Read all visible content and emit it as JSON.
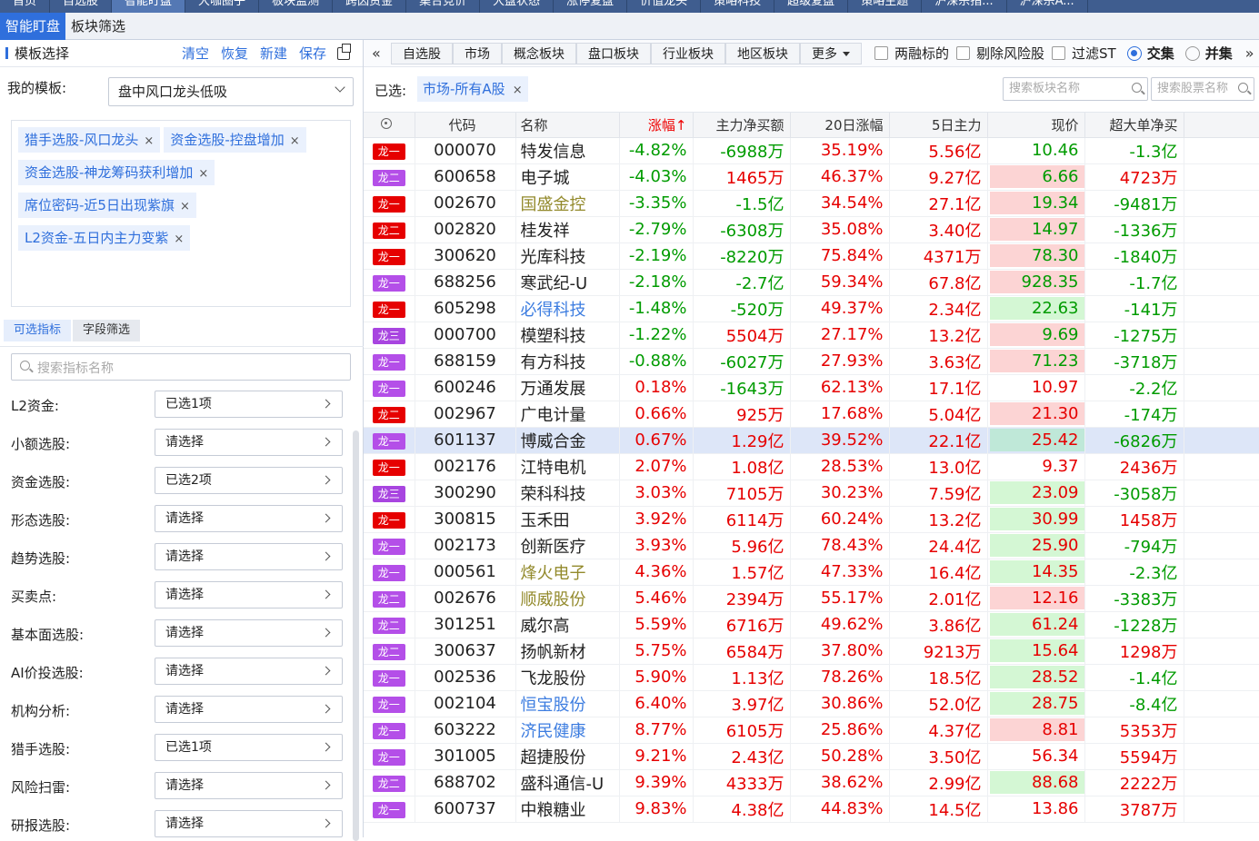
{
  "top_nav": [
    "首页",
    "自选股",
    "智能盯盘",
    "大咖圈子",
    "板块监测",
    "跨因资金",
    "集合竞价",
    "大盘状态",
    "涨停复盘",
    "价值龙头",
    "策略科技",
    "超级复盘",
    "策略主题",
    "沪深宗指...",
    "沪深宗A..."
  ],
  "top_nav_active": 2,
  "sub_tabs": [
    "智能盯盘",
    "板块筛选"
  ],
  "left": {
    "title": "模板选择",
    "actions": [
      "清空",
      "恢复",
      "新建",
      "保存"
    ],
    "my_template_label": "我的模板:",
    "my_template_value": "盘中风口龙头低吸",
    "tags": [
      "猎手选股-风口龙头",
      "资金选股-控盘增加",
      "资金选股-神龙筹码获利增加",
      "席位密码-近5日出现紫旗",
      "L2资金-五日内主力变紫"
    ],
    "tabs": [
      "可选指标",
      "字段筛选"
    ],
    "search_placeholder": "搜索指标名称",
    "filters": [
      {
        "label": "L2资金:",
        "value": "已选1项"
      },
      {
        "label": "小额选股:",
        "value": "请选择"
      },
      {
        "label": "资金选股:",
        "value": "已选2项"
      },
      {
        "label": "形态选股:",
        "value": "请选择"
      },
      {
        "label": "趋势选股:",
        "value": "请选择"
      },
      {
        "label": "买卖点:",
        "value": "请选择"
      },
      {
        "label": "基本面选股:",
        "value": "请选择"
      },
      {
        "label": "AI价投选股:",
        "value": "请选择"
      },
      {
        "label": "机构分析:",
        "value": "请选择"
      },
      {
        "label": "猎手选股:",
        "value": "已选1项"
      },
      {
        "label": "风险扫雷:",
        "value": "请选择"
      },
      {
        "label": "研报选股:",
        "value": "请选择"
      }
    ]
  },
  "toolbar": {
    "left_arrow": "«",
    "right_arrow": "»",
    "buttons": [
      "自选股",
      "市场",
      "概念板块",
      "盘口板块",
      "行业板块",
      "地区板块"
    ],
    "more": "更多",
    "checks": [
      "两融标的",
      "剔除风险股",
      "过滤ST"
    ],
    "radios": [
      "交集",
      "并集"
    ],
    "radio_selected": 0
  },
  "selected": {
    "label": "已选:",
    "chip": "市场-所有A股",
    "search_sector_placeholder": "搜索板块名称",
    "search_stock_placeholder": "搜索股票名称"
  },
  "table": {
    "headers": [
      "代码",
      "名称",
      "涨幅↑",
      "主力净买额",
      "20日涨幅",
      "5日主力",
      "现价",
      "超大单净买"
    ],
    "badge_colors": {
      "龙一": "#e60000",
      "龙二": "#b44fe8",
      "龙三": "#a845e0"
    },
    "rows": [
      {
        "badge": "龙一",
        "bc": "#e60000",
        "code": "000070",
        "name": "特发信息",
        "nc": "blk",
        "chg": "-4.82%",
        "cc": "dn",
        "net": "-6988万",
        "netc": "dn",
        "d20": "35.19%",
        "d20c": "up",
        "m5": "5.56亿",
        "m5c": "up",
        "price": "10.46",
        "pc": "dn",
        "pbg": "",
        "sup": "-1.3亿",
        "supc": "dn"
      },
      {
        "badge": "龙二",
        "bc": "#b44fe8",
        "code": "600658",
        "name": "电子城",
        "nc": "blk",
        "chg": "-4.03%",
        "cc": "dn",
        "net": "1465万",
        "netc": "up",
        "d20": "46.37%",
        "d20c": "up",
        "m5": "9.27亿",
        "m5c": "up",
        "price": "6.66",
        "pc": "dn",
        "pbg": "#fcd4d4",
        "sup": "4723万",
        "supc": "up"
      },
      {
        "badge": "龙一",
        "bc": "#e60000",
        "code": "002670",
        "name": "国盛金控",
        "nc": "olv",
        "chg": "-3.35%",
        "cc": "dn",
        "net": "-1.5亿",
        "netc": "dn",
        "d20": "34.54%",
        "d20c": "up",
        "m5": "27.1亿",
        "m5c": "up",
        "price": "19.34",
        "pc": "dn",
        "pbg": "#fcd4d4",
        "sup": "-9481万",
        "supc": "dn"
      },
      {
        "badge": "龙二",
        "bc": "#e60000",
        "code": "002820",
        "name": "桂发祥",
        "nc": "blk",
        "chg": "-2.79%",
        "cc": "dn",
        "net": "-6308万",
        "netc": "dn",
        "d20": "35.08%",
        "d20c": "up",
        "m5": "3.40亿",
        "m5c": "up",
        "price": "14.97",
        "pc": "dn",
        "pbg": "#fcd4d4",
        "sup": "-1336万",
        "supc": "dn"
      },
      {
        "badge": "龙一",
        "bc": "#e60000",
        "code": "300620",
        "name": "光库科技",
        "nc": "blk",
        "chg": "-2.19%",
        "cc": "dn",
        "net": "-8220万",
        "netc": "dn",
        "d20": "75.84%",
        "d20c": "up",
        "m5": "4371万",
        "m5c": "up",
        "price": "78.30",
        "pc": "dn",
        "pbg": "#fcd4d4",
        "sup": "-1840万",
        "supc": "dn"
      },
      {
        "badge": "龙一",
        "bc": "#b44fe8",
        "code": "688256",
        "name": "寒武纪-U",
        "nc": "blk",
        "chg": "-2.18%",
        "cc": "dn",
        "net": "-2.7亿",
        "netc": "dn",
        "d20": "59.34%",
        "d20c": "up",
        "m5": "67.8亿",
        "m5c": "up",
        "price": "928.35",
        "pc": "dn",
        "pbg": "#fcd4d4",
        "sup": "-1.7亿",
        "supc": "dn"
      },
      {
        "badge": "龙一",
        "bc": "#e60000",
        "code": "605298",
        "name": "必得科技",
        "nc": "lnk",
        "chg": "-1.48%",
        "cc": "dn",
        "net": "-520万",
        "netc": "dn",
        "d20": "49.37%",
        "d20c": "up",
        "m5": "2.34亿",
        "m5c": "up",
        "price": "22.63",
        "pc": "dn",
        "pbg": "#d4f7d4",
        "sup": "-141万",
        "supc": "dn"
      },
      {
        "badge": "龙三",
        "bc": "#a845e0",
        "code": "000700",
        "name": "模塑科技",
        "nc": "blk",
        "chg": "-1.22%",
        "cc": "dn",
        "net": "5504万",
        "netc": "up",
        "d20": "27.17%",
        "d20c": "up",
        "m5": "13.2亿",
        "m5c": "up",
        "price": "9.69",
        "pc": "dn",
        "pbg": "#fcd4d4",
        "sup": "-1275万",
        "supc": "dn"
      },
      {
        "badge": "龙一",
        "bc": "#b44fe8",
        "code": "688159",
        "name": "有方科技",
        "nc": "blk",
        "chg": "-0.88%",
        "cc": "dn",
        "net": "-6027万",
        "netc": "dn",
        "d20": "27.93%",
        "d20c": "up",
        "m5": "3.63亿",
        "m5c": "up",
        "price": "71.23",
        "pc": "dn",
        "pbg": "#fcd4d4",
        "sup": "-3718万",
        "supc": "dn"
      },
      {
        "badge": "龙一",
        "bc": "#b44fe8",
        "code": "600246",
        "name": "万通发展",
        "nc": "blk",
        "chg": "0.18%",
        "cc": "up",
        "net": "-1643万",
        "netc": "dn",
        "d20": "62.13%",
        "d20c": "up",
        "m5": "17.1亿",
        "m5c": "up",
        "price": "10.97",
        "pc": "up",
        "pbg": "",
        "sup": "-2.2亿",
        "supc": "dn"
      },
      {
        "badge": "龙二",
        "bc": "#e60000",
        "code": "002967",
        "name": "广电计量",
        "nc": "blk",
        "chg": "0.66%",
        "cc": "up",
        "net": "925万",
        "netc": "up",
        "d20": "17.68%",
        "d20c": "up",
        "m5": "5.04亿",
        "m5c": "up",
        "price": "21.30",
        "pc": "up",
        "pbg": "#fcd4d4",
        "sup": "-174万",
        "supc": "dn"
      },
      {
        "badge": "龙一",
        "bc": "#b44fe8",
        "code": "601137",
        "name": "博威合金",
        "nc": "blk",
        "chg": "0.67%",
        "cc": "up",
        "net": "1.29亿",
        "netc": "up",
        "d20": "39.52%",
        "d20c": "up",
        "m5": "22.1亿",
        "m5c": "up",
        "price": "25.42",
        "pc": "up",
        "pbg": "#bfe8d8",
        "sup": "-6826万",
        "supc": "dn",
        "sel": true
      },
      {
        "badge": "龙一",
        "bc": "#e60000",
        "code": "002176",
        "name": "江特电机",
        "nc": "blk",
        "chg": "2.07%",
        "cc": "up",
        "net": "1.08亿",
        "netc": "up",
        "d20": "28.53%",
        "d20c": "up",
        "m5": "13.0亿",
        "m5c": "up",
        "price": "9.37",
        "pc": "up",
        "pbg": "",
        "sup": "2436万",
        "supc": "up"
      },
      {
        "badge": "龙三",
        "bc": "#a845e0",
        "code": "300290",
        "name": "荣科科技",
        "nc": "blk",
        "chg": "3.03%",
        "cc": "up",
        "net": "7105万",
        "netc": "up",
        "d20": "30.23%",
        "d20c": "up",
        "m5": "7.59亿",
        "m5c": "up",
        "price": "23.09",
        "pc": "up",
        "pbg": "#d4f7d4",
        "sup": "-3058万",
        "supc": "dn"
      },
      {
        "badge": "龙一",
        "bc": "#e60000",
        "code": "300815",
        "name": "玉禾田",
        "nc": "blk",
        "chg": "3.92%",
        "cc": "up",
        "net": "6114万",
        "netc": "up",
        "d20": "60.24%",
        "d20c": "up",
        "m5": "13.2亿",
        "m5c": "up",
        "price": "30.99",
        "pc": "up",
        "pbg": "#d4f7d4",
        "sup": "1458万",
        "supc": "up"
      },
      {
        "badge": "龙一",
        "bc": "#b44fe8",
        "code": "002173",
        "name": "创新医疗",
        "nc": "blk",
        "chg": "3.93%",
        "cc": "up",
        "net": "5.96亿",
        "netc": "up",
        "d20": "78.43%",
        "d20c": "up",
        "m5": "24.4亿",
        "m5c": "up",
        "price": "25.90",
        "pc": "up",
        "pbg": "#d4f7d4",
        "sup": "-794万",
        "supc": "dn"
      },
      {
        "badge": "龙一",
        "bc": "#b44fe8",
        "code": "000561",
        "name": "烽火电子",
        "nc": "olv",
        "chg": "4.36%",
        "cc": "up",
        "net": "1.57亿",
        "netc": "up",
        "d20": "47.33%",
        "d20c": "up",
        "m5": "16.4亿",
        "m5c": "up",
        "price": "14.35",
        "pc": "up",
        "pbg": "#d4f7d4",
        "sup": "-2.3亿",
        "supc": "dn"
      },
      {
        "badge": "龙二",
        "bc": "#b44fe8",
        "code": "002676",
        "name": "顺威股份",
        "nc": "olv",
        "chg": "5.46%",
        "cc": "up",
        "net": "2394万",
        "netc": "up",
        "d20": "55.17%",
        "d20c": "up",
        "m5": "2.01亿",
        "m5c": "up",
        "price": "12.16",
        "pc": "up",
        "pbg": "#fcd4d4",
        "sup": "-3383万",
        "supc": "dn"
      },
      {
        "badge": "龙二",
        "bc": "#b44fe8",
        "code": "301251",
        "name": "威尔高",
        "nc": "blk",
        "chg": "5.59%",
        "cc": "up",
        "net": "6716万",
        "netc": "up",
        "d20": "49.62%",
        "d20c": "up",
        "m5": "3.86亿",
        "m5c": "up",
        "price": "61.24",
        "pc": "up",
        "pbg": "#d4f7d4",
        "sup": "-1228万",
        "supc": "dn"
      },
      {
        "badge": "龙二",
        "bc": "#b44fe8",
        "code": "300637",
        "name": "扬帆新材",
        "nc": "blk",
        "chg": "5.75%",
        "cc": "up",
        "net": "6584万",
        "netc": "up",
        "d20": "37.80%",
        "d20c": "up",
        "m5": "9213万",
        "m5c": "up",
        "price": "15.64",
        "pc": "up",
        "pbg": "#d4f7d4",
        "sup": "1298万",
        "supc": "up"
      },
      {
        "badge": "龙一",
        "bc": "#b44fe8",
        "code": "002536",
        "name": "飞龙股份",
        "nc": "blk",
        "chg": "5.90%",
        "cc": "up",
        "net": "1.13亿",
        "netc": "up",
        "d20": "78.26%",
        "d20c": "up",
        "m5": "18.5亿",
        "m5c": "up",
        "price": "28.52",
        "pc": "up",
        "pbg": "#d4f7d4",
        "sup": "-1.4亿",
        "supc": "dn"
      },
      {
        "badge": "龙一",
        "bc": "#b44fe8",
        "code": "002104",
        "name": "恒宝股份",
        "nc": "lnk",
        "chg": "6.40%",
        "cc": "up",
        "net": "3.97亿",
        "netc": "up",
        "d20": "30.86%",
        "d20c": "up",
        "m5": "52.0亿",
        "m5c": "up",
        "price": "28.75",
        "pc": "up",
        "pbg": "#d4f7d4",
        "sup": "-8.4亿",
        "supc": "dn"
      },
      {
        "badge": "龙一",
        "bc": "#b44fe8",
        "code": "603222",
        "name": "济民健康",
        "nc": "lnk",
        "chg": "8.77%",
        "cc": "up",
        "net": "6105万",
        "netc": "up",
        "d20": "25.86%",
        "d20c": "up",
        "m5": "4.37亿",
        "m5c": "up",
        "price": "8.81",
        "pc": "up",
        "pbg": "#fcd4d4",
        "sup": "5353万",
        "supc": "up"
      },
      {
        "badge": "龙一",
        "bc": "#b44fe8",
        "code": "301005",
        "name": "超捷股份",
        "nc": "blk",
        "chg": "9.21%",
        "cc": "up",
        "net": "2.43亿",
        "netc": "up",
        "d20": "50.28%",
        "d20c": "up",
        "m5": "3.50亿",
        "m5c": "up",
        "price": "56.34",
        "pc": "up",
        "pbg": "",
        "sup": "5594万",
        "supc": "up"
      },
      {
        "badge": "龙二",
        "bc": "#b44fe8",
        "code": "688702",
        "name": "盛科通信-U",
        "nc": "blk",
        "chg": "9.39%",
        "cc": "up",
        "net": "4333万",
        "netc": "up",
        "d20": "38.62%",
        "d20c": "up",
        "m5": "2.99亿",
        "m5c": "up",
        "price": "88.68",
        "pc": "up",
        "pbg": "#d4f7d4",
        "sup": "2222万",
        "supc": "up"
      },
      {
        "badge": "龙一",
        "bc": "#b44fe8",
        "code": "600737",
        "name": "中粮糖业",
        "nc": "blk",
        "chg": "9.83%",
        "cc": "up",
        "net": "4.38亿",
        "netc": "up",
        "d20": "44.83%",
        "d20c": "up",
        "m5": "14.5亿",
        "m5c": "up",
        "price": "13.86",
        "pc": "up",
        "pbg": "",
        "sup": "3787万",
        "supc": "up"
      }
    ]
  }
}
